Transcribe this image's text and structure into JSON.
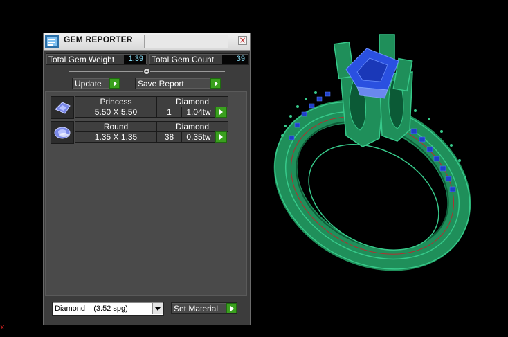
{
  "panel": {
    "title": "GEM REPORTER",
    "close_glyph": "×",
    "icon": "gem-reporter-icon"
  },
  "stats": {
    "total_weight_label": "Total Gem Weight",
    "total_weight_value": "1.39",
    "total_count_label": "Total Gem Count",
    "total_count_value": "39"
  },
  "actions": {
    "update_label": "Update",
    "save_report_label": "Save Report"
  },
  "gems": [
    {
      "shape": "Princess",
      "size": "5.50 X 5.50",
      "material": "Diamond",
      "count": "1",
      "weight": "1.04tw",
      "thumb_icon": "princess-cut-gem-icon"
    },
    {
      "shape": "Round",
      "size": "1.35 X 1.35",
      "material": "Diamond",
      "count": "38",
      "weight": "0.35tw",
      "thumb_icon": "round-cut-gem-icon"
    }
  ],
  "material_select": {
    "value": "Diamond    (3.52 spg)"
  },
  "set_material_label": "Set Material",
  "viewport": {
    "axis_label": "x"
  },
  "colors": {
    "accent_green": "#3aa01e",
    "value_cyan": "#8fe6ff",
    "ring_green": "#1f8f5a",
    "gem_blue": "#2040c8"
  }
}
